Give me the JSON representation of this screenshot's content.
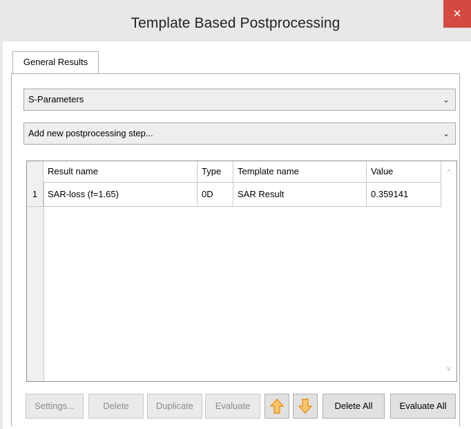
{
  "window": {
    "title": "Template Based Postprocessing",
    "close_glyph": "×"
  },
  "tabs": [
    {
      "label": "General Results"
    }
  ],
  "combos": {
    "result_type": {
      "value": "S-Parameters"
    },
    "postprocessing": {
      "value": "Add new postprocessing step..."
    }
  },
  "chevron_glyph": "⌄",
  "table": {
    "columns": [
      "Result name",
      "Type",
      "Template name",
      "Value"
    ],
    "rows": [
      {
        "index": "1",
        "result_name": "SAR-loss (f=1.65)",
        "type": "0D",
        "template_name": "SAR Result",
        "value": "0.359141"
      }
    ]
  },
  "scrollbar": {
    "up_glyph": "^",
    "down_glyph": "v"
  },
  "buttons": {
    "settings": "Settings...",
    "delete": "Delete",
    "duplicate": "Duplicate",
    "evaluate": "Evaluate",
    "delete_all": "Delete All",
    "evaluate_all": "Evaluate All"
  },
  "icons": {
    "move_up": "arrow-up-icon",
    "move_down": "arrow-down-icon",
    "arrow_color": "#f5a623"
  }
}
